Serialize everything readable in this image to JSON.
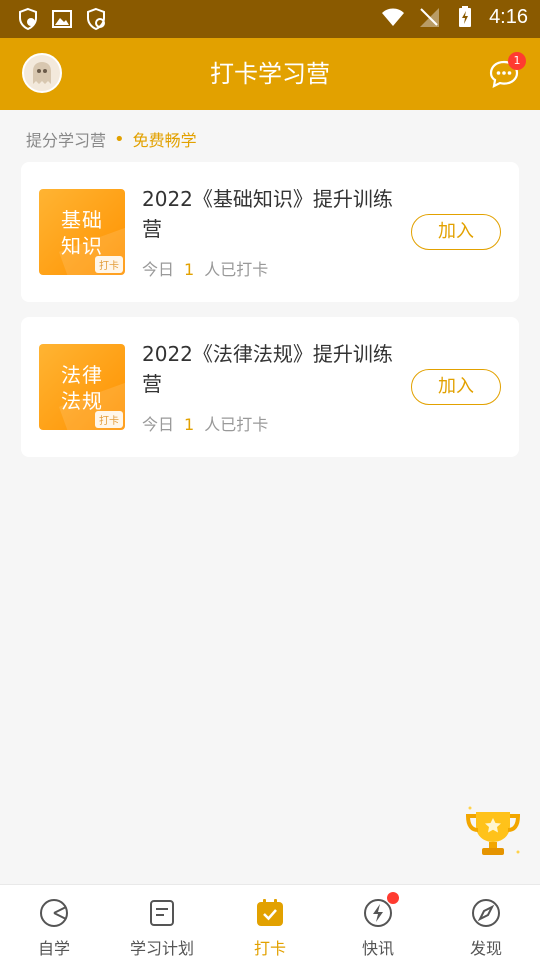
{
  "status_bar": {
    "time": "4:16",
    "left_icons": [
      "vpn-shield-icon",
      "image-icon",
      "shield-icon"
    ],
    "right_icons": [
      "wifi-icon",
      "no-signal-icon",
      "battery-charging-icon"
    ]
  },
  "header": {
    "title": "打卡学习营",
    "message_badge": "1"
  },
  "section": {
    "label": "提分学习营",
    "dot": "•",
    "free_text": "免费畅学"
  },
  "camps": [
    {
      "cover_text": "基础知识",
      "cover_tag": "打卡",
      "title": "2022《基础知识》提升训练营",
      "meta_prefix": "今日",
      "meta_count": "1",
      "meta_suffix": "人已打卡",
      "join_label": "加入"
    },
    {
      "cover_text": "法律法规",
      "cover_tag": "打卡",
      "title": "2022《法律法规》提升训练营",
      "meta_prefix": "今日",
      "meta_count": "1",
      "meta_suffix": "人已打卡",
      "join_label": "加入"
    }
  ],
  "tabs": [
    {
      "label": "自学",
      "icon": "self-study-icon",
      "active": false
    },
    {
      "label": "学习计划",
      "icon": "study-plan-icon",
      "active": false
    },
    {
      "label": "打卡",
      "icon": "checkin-icon",
      "active": true
    },
    {
      "label": "快讯",
      "icon": "news-flash-icon",
      "active": false,
      "dot": true
    },
    {
      "label": "发现",
      "icon": "compass-icon",
      "active": false
    }
  ],
  "colors": {
    "accent": "#e2a100",
    "status_bar": "#8a5a00",
    "badge": "#ff3b30"
  }
}
